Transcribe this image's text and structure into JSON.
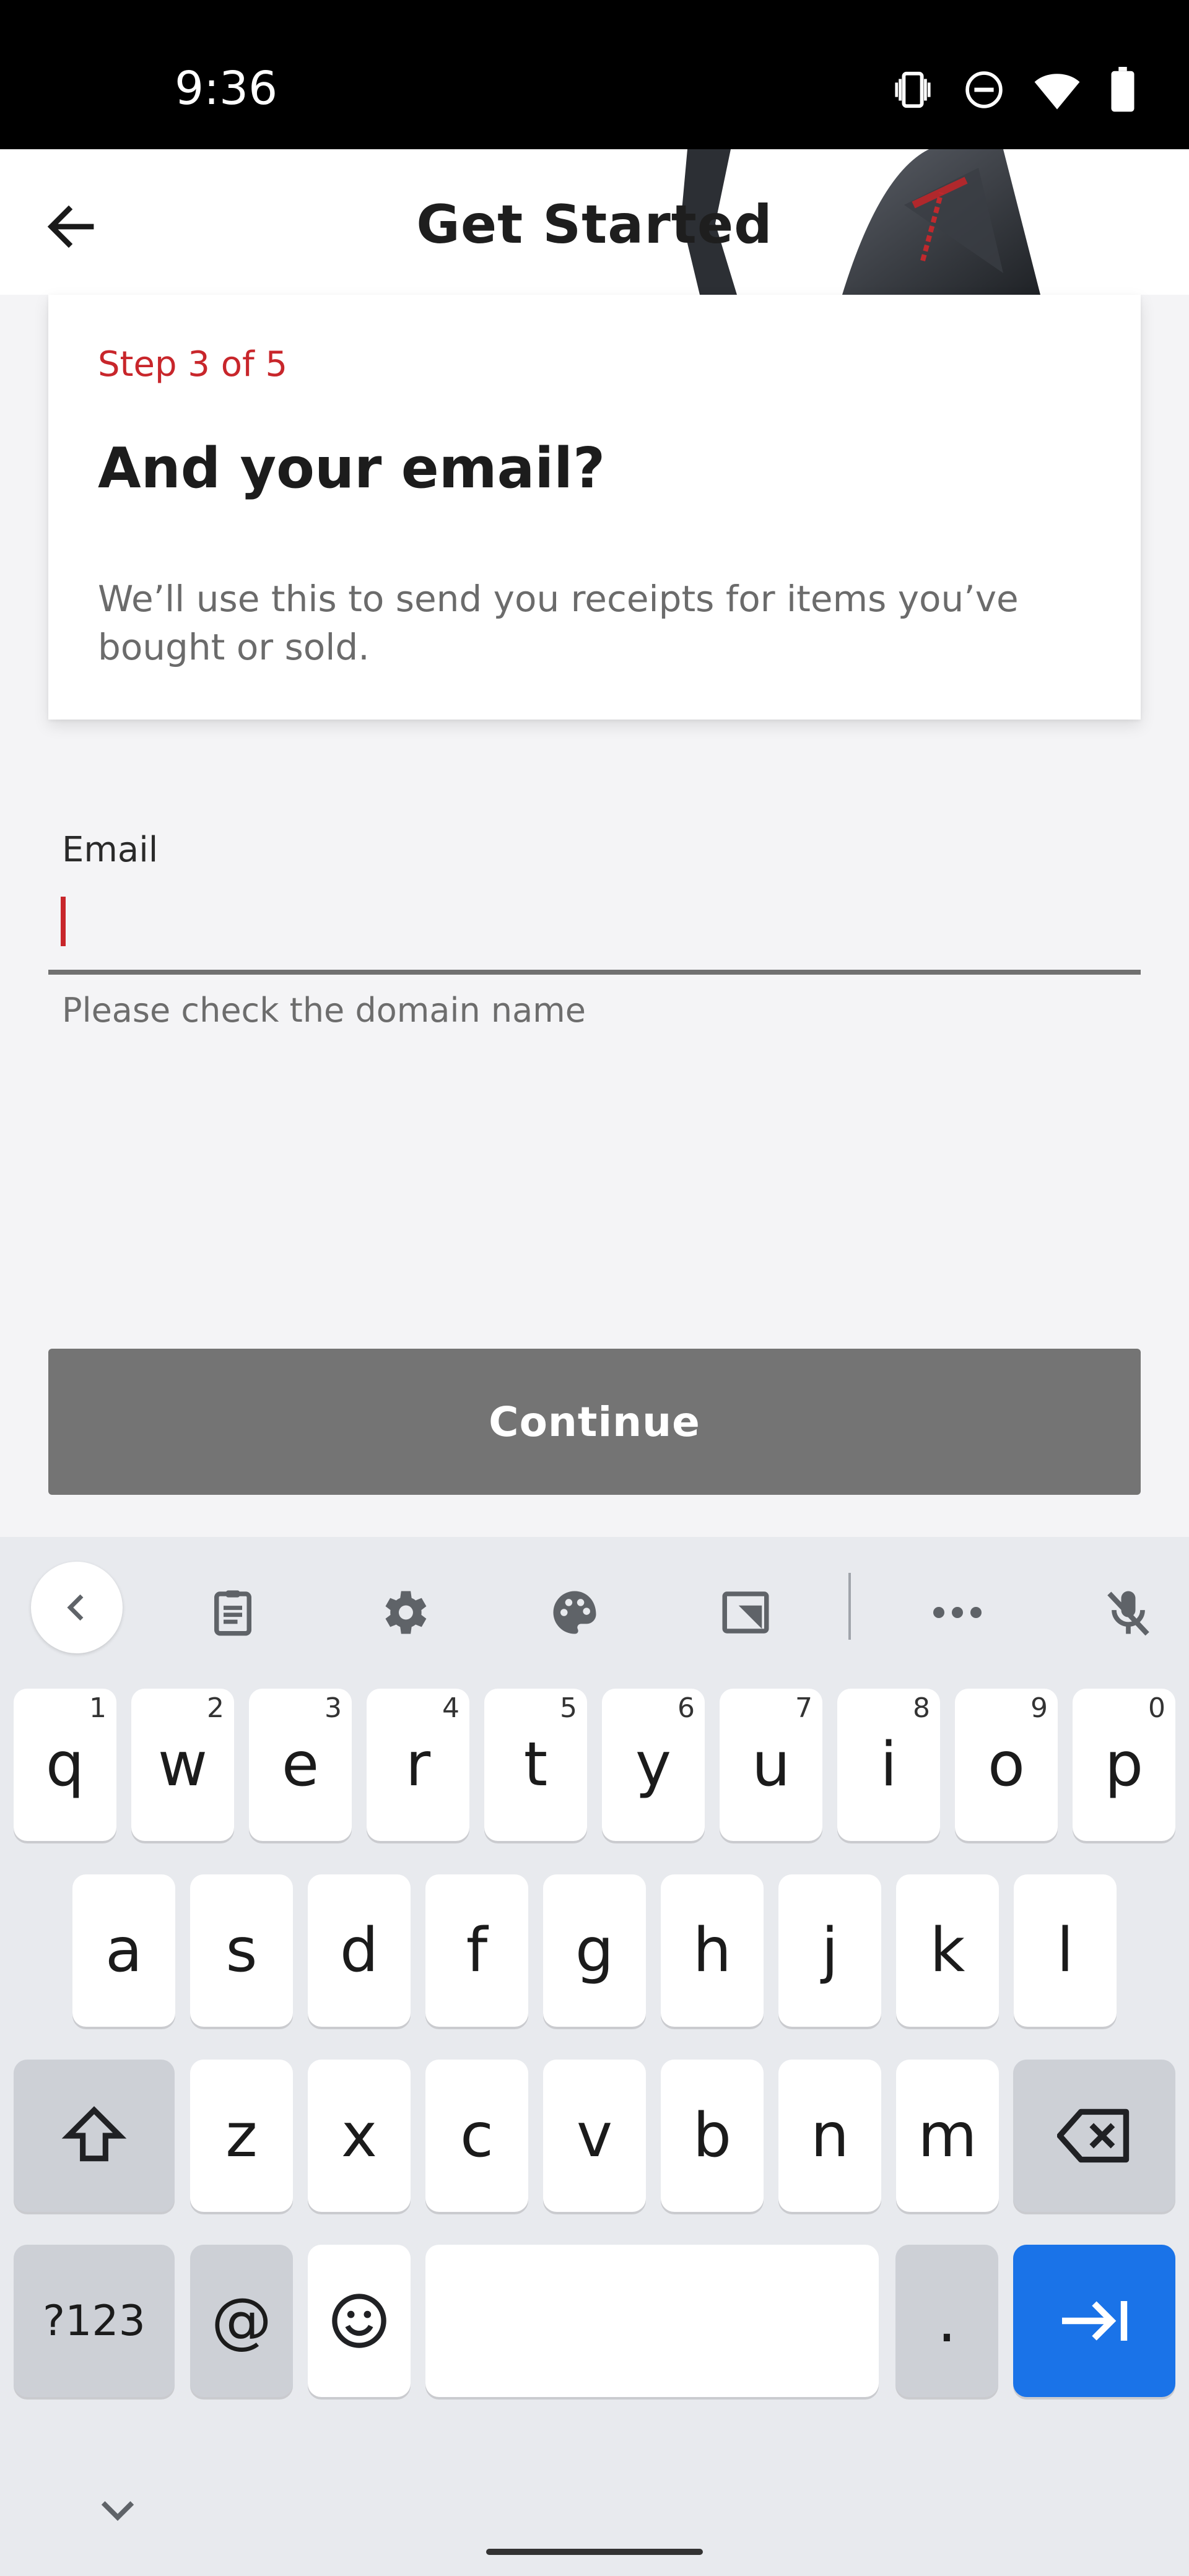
{
  "status_bar": {
    "time": "9:36"
  },
  "header": {
    "title": "Get Started"
  },
  "card": {
    "step": "Step 3 of 5",
    "title": "And your email?",
    "description": "We’ll use this to send you receipts for items you’ve bought or sold."
  },
  "email": {
    "label": "Email",
    "value": "",
    "helper": "Please check the domain name"
  },
  "continue_button": {
    "label": "Continue"
  },
  "keyboard": {
    "row1": [
      {
        "key": "q",
        "hint": "1"
      },
      {
        "key": "w",
        "hint": "2"
      },
      {
        "key": "e",
        "hint": "3"
      },
      {
        "key": "r",
        "hint": "4"
      },
      {
        "key": "t",
        "hint": "5"
      },
      {
        "key": "y",
        "hint": "6"
      },
      {
        "key": "u",
        "hint": "7"
      },
      {
        "key": "i",
        "hint": "8"
      },
      {
        "key": "o",
        "hint": "9"
      },
      {
        "key": "p",
        "hint": "0"
      }
    ],
    "row2": [
      "a",
      "s",
      "d",
      "f",
      "g",
      "h",
      "j",
      "k",
      "l"
    ],
    "row3": [
      "z",
      "x",
      "c",
      "v",
      "b",
      "n",
      "m"
    ],
    "symbols_key": "?123",
    "at_key": "@",
    "period_key": ".",
    "accent_color": "#1a73e8"
  },
  "icons": [
    "back-arrow-icon",
    "vibrate-icon",
    "do-not-disturb-icon",
    "wifi-icon",
    "battery-icon",
    "clipboard-icon",
    "settings-gear-icon",
    "palette-icon",
    "floating-keyboard-icon",
    "more-icon",
    "mic-off-icon",
    "shift-icon",
    "backspace-icon",
    "emoji-icon",
    "enter-tab-icon",
    "keyboard-hide-icon"
  ]
}
